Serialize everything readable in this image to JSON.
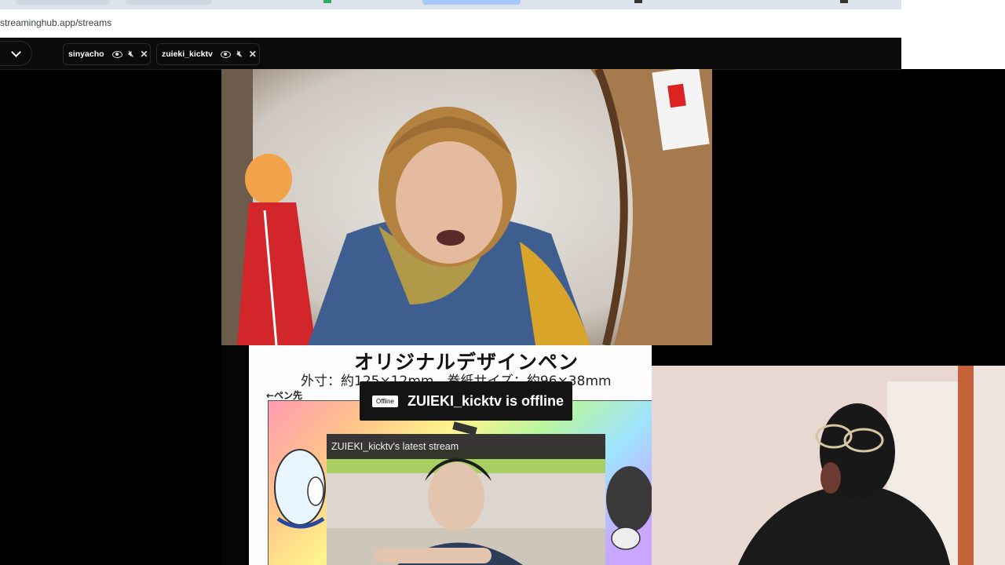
{
  "browser": {
    "url": "streaminghub.app/streams"
  },
  "streams": [
    {
      "name": "sinyacho"
    },
    {
      "name": "zuieki_kicktv"
    }
  ],
  "product": {
    "title": "オリジナルデザインペン",
    "dimensions": "外寸：約125×12mm　巻紙サイズ：約96×38mm",
    "tip_label": "←ペン先"
  },
  "offline": {
    "badge": "Offline",
    "message": "ZUIEKI_kicktv is offline"
  },
  "latest_stream": {
    "title": "ZUIEKI_kicktv's latest stream"
  }
}
